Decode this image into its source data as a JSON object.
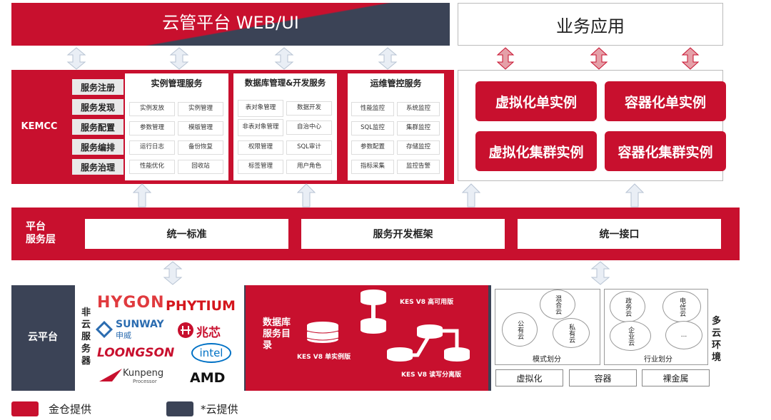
{
  "header": {
    "title": "云管平台 WEB/UI",
    "business_title": "业务应用"
  },
  "kemcc": {
    "label": "KEMCC",
    "side_items": [
      "服务注册",
      "服务发现",
      "服务配置",
      "服务编排",
      "服务治理"
    ],
    "instance": {
      "title": "实例管理服务",
      "cells": [
        "实例发放",
        "实例管理",
        "参数管理",
        "模版管理",
        "运行日志",
        "备份恢复",
        "性能优化",
        "回收站"
      ]
    },
    "database": {
      "title": "数据库管理&开发服务",
      "cells": [
        "表对象管理",
        "数据开发",
        "非表对象管理",
        "自治中心",
        "权限管理",
        "SQL审计",
        "标签管理",
        "用户角色"
      ]
    },
    "ops": {
      "title": "运维管控服务",
      "cells": [
        "性能监控",
        "系统监控",
        "SQL监控",
        "集群监控",
        "参数配置",
        "存储监控",
        "指标采集",
        "监控告警"
      ]
    }
  },
  "business": {
    "items": [
      "虚拟化单实例",
      "容器化单实例",
      "虚拟化集群实例",
      "容器化集群实例"
    ]
  },
  "platform": {
    "label_line1": "平台",
    "label_line2": "服务层",
    "items": [
      "统一标准",
      "服务开发框架",
      "统一接口"
    ]
  },
  "bottom": {
    "cloud_label": "云平台",
    "vendor_label": "非云服务器",
    "vendors": {
      "hygon": "HYGON",
      "phytium": "PHYTIUM",
      "sunway": "SUNWAY",
      "sunway_cn": "申威",
      "zhaoxin": "兆芯",
      "loongson": "LOONGSON",
      "intel": "intel",
      "kunpeng": "Kunpeng",
      "kunpeng_sub": "Processor",
      "amd": "AMD"
    },
    "db_catalog": "数据库服务目录",
    "kes": {
      "ha": "KES V8 高可用版",
      "single": "KES V8 单实例版",
      "rw": "KES V8 读写分离版"
    },
    "clouds_mode": {
      "items": [
        "混合云",
        "公有云",
        "私有云"
      ],
      "caption": "模式划分"
    },
    "clouds_industry": {
      "items": [
        "政务云",
        "电信云",
        "企业云",
        "..."
      ],
      "caption": "行业划分"
    },
    "envs": [
      "虚拟化",
      "容器",
      "裸金属"
    ],
    "multi_cloud": "多云环境"
  },
  "legend": {
    "red": "金仓提供",
    "dark": "*云提供"
  },
  "colors": {
    "brand_red": "#c8102e",
    "dark": "#3b4356"
  }
}
